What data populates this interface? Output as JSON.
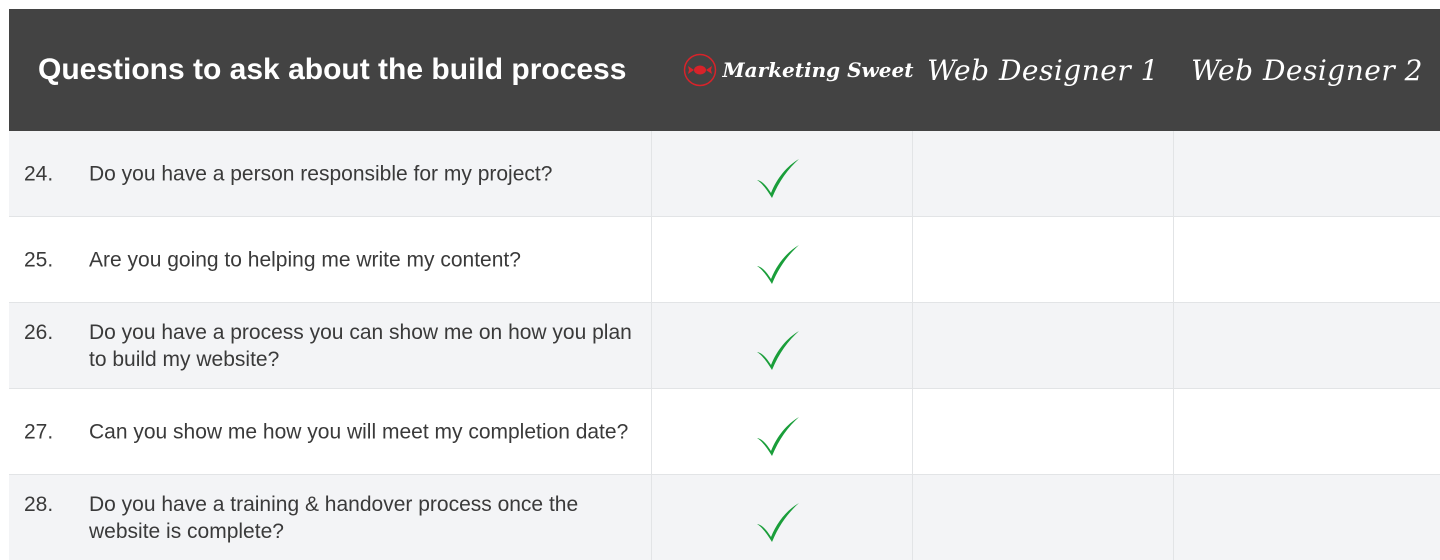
{
  "header": {
    "title": "Questions to ask about the build process",
    "columns": [
      "Marketing Sweet",
      "Web Designer 1",
      "Web Designer 2"
    ]
  },
  "colors": {
    "header_bg": "#434343",
    "alt_row": "#f3f4f6",
    "check": "#1a9e3a",
    "logo": "#d8232a"
  },
  "rows": [
    {
      "number": "24.",
      "question": "Do you have a person responsible for my project?",
      "marketing_sweet": "check",
      "designer1": "",
      "designer2": ""
    },
    {
      "number": "25.",
      "question": "Are you going to helping me write my content?",
      "marketing_sweet": "check",
      "designer1": "",
      "designer2": ""
    },
    {
      "number": "26.",
      "question": "Do you have a process you can show me on how you plan to build my website?",
      "marketing_sweet": "check",
      "designer1": "",
      "designer2": ""
    },
    {
      "number": "27.",
      "question": "Can you show me how you will meet my completion date?",
      "marketing_sweet": "check",
      "designer1": "",
      "designer2": ""
    },
    {
      "number": "28.",
      "question": "Do you have a training & handover process once the website is complete?",
      "marketing_sweet": "check",
      "designer1": "",
      "designer2": ""
    }
  ],
  "icons": {
    "logo": "candy-logo-icon",
    "check": "check-icon"
  }
}
